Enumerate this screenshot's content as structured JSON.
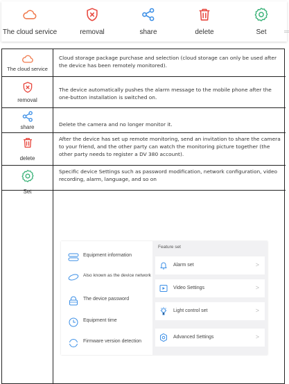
{
  "toolbar": {
    "items": [
      {
        "label": "The cloud service",
        "icon": "cloud-icon"
      },
      {
        "label": "removal",
        "icon": "shield-x-icon"
      },
      {
        "label": "share",
        "icon": "share-icon"
      },
      {
        "label": "delete",
        "icon": "trash-icon"
      },
      {
        "label": "Set",
        "icon": "gear-icon"
      }
    ]
  },
  "table": {
    "rows": [
      {
        "label": "The cloud service",
        "icon": "cloud-icon",
        "desc": "Cloud storage package purchase and selection (cloud storage can only be used after the device has been remotely monitored)."
      },
      {
        "label": "removal",
        "icon": "shield-x-icon",
        "desc": "The device automatically pushes the alarm message to the mobile phone after the one-button installation is switched on."
      },
      {
        "label": "share",
        "icon": "share-icon",
        "desc": "Delete the camera and no longer monitor it."
      },
      {
        "label": "delete",
        "icon": "trash-icon",
        "desc": "After the device has set up remote monitoring, send an invitation to share the camera to your friend, and the other party can watch the monitoring picture together (the other party needs to register a DV 380 account)."
      },
      {
        "label": "Set",
        "icon": "gear-icon",
        "desc": "Specific device Settings such as password modification, network configuration, video recording, alarm, language, and so on"
      }
    ]
  },
  "settings": {
    "left_items": [
      {
        "label": "Equipment information",
        "icon": "equipment-info-icon"
      },
      {
        "label": "Also known as the device network",
        "icon": "network-icon"
      },
      {
        "label": "The device password",
        "icon": "lock-icon"
      },
      {
        "label": "Equipment time",
        "icon": "clock-icon"
      },
      {
        "label": "Firmware version detection",
        "icon": "refresh-icon"
      }
    ],
    "feature_title": "Feature set",
    "right_items": [
      {
        "label": "Alarm set",
        "icon": "bell-icon"
      },
      {
        "label": "Video Settings",
        "icon": "video-icon"
      },
      {
        "label": "Light control set",
        "icon": "bulb-icon"
      },
      {
        "label": "Advanced Settings",
        "icon": "advanced-settings-icon"
      }
    ],
    "chevron": ">"
  },
  "colors": {
    "accent_orange": "#f07a4d",
    "accent_red": "#e8483f",
    "accent_green": "#3db37a",
    "accent_blue": "#3a8ee6"
  }
}
